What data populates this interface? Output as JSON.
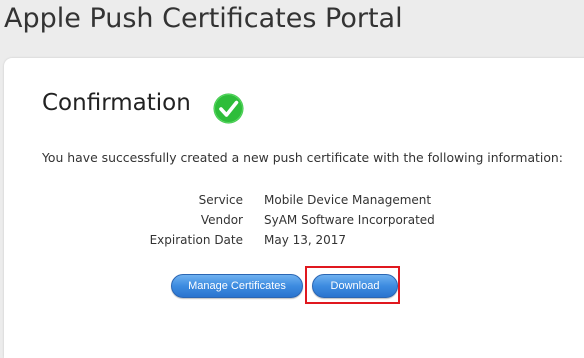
{
  "header": {
    "title": "Apple Push Certificates Portal"
  },
  "confirmation": {
    "title": "Confirmation",
    "icon": "check-circle-icon",
    "intro": "You have successfully created a new push certificate with the following information:",
    "details": [
      {
        "label": "Service",
        "value": "Mobile Device Management"
      },
      {
        "label": "Vendor",
        "value": "SyAM Software Incorporated"
      },
      {
        "label": "Expiration Date",
        "value": "May 13, 2017"
      }
    ]
  },
  "actions": {
    "manage_label": "Manage Certificates",
    "download_label": "Download"
  },
  "colors": {
    "check": "#2ebd3a",
    "button": "#3d8be0",
    "highlight": "#e0181f"
  }
}
